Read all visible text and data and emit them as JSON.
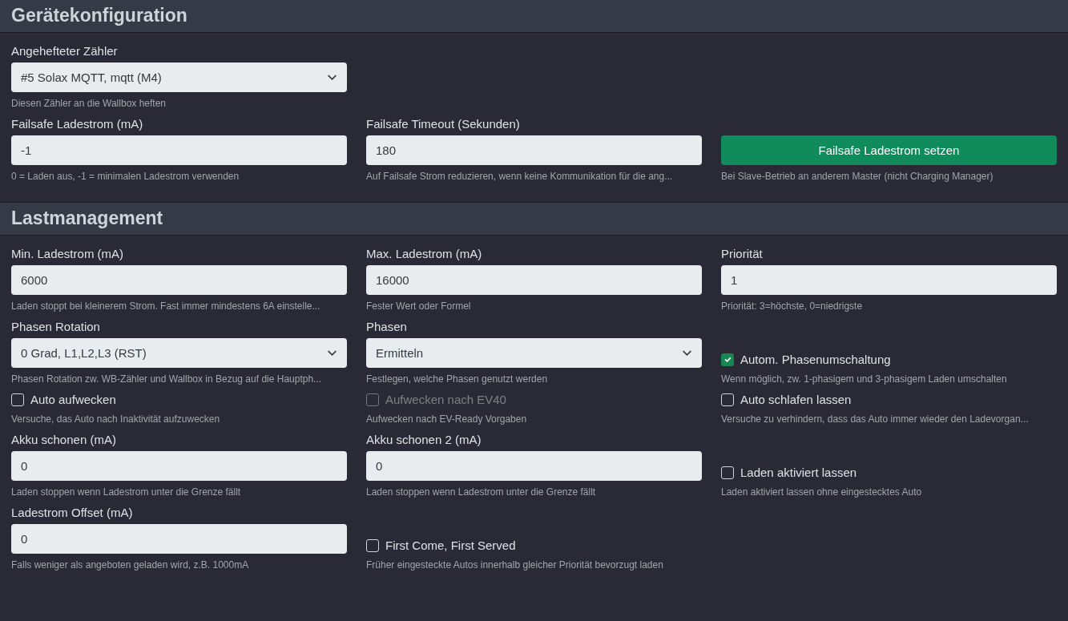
{
  "sections": [
    {
      "title": "Gerätekonfiguration",
      "rows": [
        [
          {
            "kind": "select",
            "label": "Angehefteter Zähler",
            "value": "#5 Solax MQTT, mqtt (M4)",
            "help": "Diesen Zähler an die Wallbox heften"
          },
          {
            "kind": "empty"
          },
          {
            "kind": "empty"
          }
        ],
        [
          {
            "kind": "input",
            "label": "Failsafe Ladestrom (mA)",
            "value": "-1",
            "help": "0 = Laden aus, -1 = minimalen Ladestrom verwenden"
          },
          {
            "kind": "input",
            "label": "Failsafe Timeout (Sekunden)",
            "value": "180",
            "help": "Auf Failsafe Strom reduzieren, wenn keine Kommunikation für die ang..."
          },
          {
            "kind": "button",
            "value": "Failsafe Ladestrom setzen",
            "help": "Bei Slave-Betrieb an anderem Master (nicht Charging Manager)"
          }
        ]
      ]
    },
    {
      "title": "Lastmanagement",
      "rows": [
        [
          {
            "kind": "input",
            "label": "Min. Ladestrom (mA)",
            "value": "6000",
            "help": "Laden stoppt bei kleinerem Strom. Fast immer mindestens 6A einstelle..."
          },
          {
            "kind": "input",
            "label": "Max. Ladestrom (mA)",
            "value": "16000",
            "help": "Fester Wert oder Formel"
          },
          {
            "kind": "input",
            "label": "Priorität",
            "value": "1",
            "help": "Priorität: 3=höchste, 0=niedrigste"
          }
        ],
        [
          {
            "kind": "select",
            "label": "Phasen Rotation",
            "value": "0 Grad, L1,L2,L3 (RST)",
            "help": "Phasen Rotation zw. WB-Zähler und Wallbox in Bezug auf die Hauptph..."
          },
          {
            "kind": "select",
            "label": "Phasen",
            "value": "Ermitteln",
            "help": "Festlegen, welche Phasen genutzt werden"
          },
          {
            "kind": "checkbox",
            "label": "Autom. Phasenumschaltung",
            "checked": true,
            "disabled": false,
            "help": "Wenn möglich, zw. 1-phasigem und 3-phasigem Laden umschalten"
          }
        ],
        [
          {
            "kind": "checkbox",
            "label": "Auto aufwecken",
            "checked": false,
            "disabled": false,
            "help": "Versuche, das Auto nach Inaktivität aufzuwecken"
          },
          {
            "kind": "checkbox",
            "label": "Aufwecken nach EV40",
            "checked": false,
            "disabled": true,
            "help": "Aufwecken nach EV-Ready Vorgaben"
          },
          {
            "kind": "checkbox",
            "label": "Auto schlafen lassen",
            "checked": false,
            "disabled": false,
            "help": "Versuche zu verhindern, dass das Auto immer wieder den Ladevorgan..."
          }
        ],
        [
          {
            "kind": "input",
            "label": "Akku schonen (mA)",
            "value": "0",
            "help": "Laden stoppen wenn Ladestrom unter die Grenze fällt"
          },
          {
            "kind": "input",
            "label": "Akku schonen 2 (mA)",
            "value": "0",
            "help": "Laden stoppen wenn Ladestrom unter die Grenze fällt"
          },
          {
            "kind": "checkbox",
            "label": "Laden aktiviert lassen",
            "checked": false,
            "disabled": false,
            "help": "Laden aktiviert lassen ohne eingestecktes Auto"
          }
        ],
        [
          {
            "kind": "input",
            "label": "Ladestrom Offset (mA)",
            "value": "0",
            "help": "Falls weniger als angeboten geladen wird, z.B. 1000mA"
          },
          {
            "kind": "checkbox",
            "label": "First Come, First Served",
            "checked": false,
            "disabled": false,
            "help": "Früher eingesteckte Autos innerhalb gleicher Priorität bevorzugt laden"
          },
          {
            "kind": "empty"
          }
        ]
      ]
    }
  ]
}
